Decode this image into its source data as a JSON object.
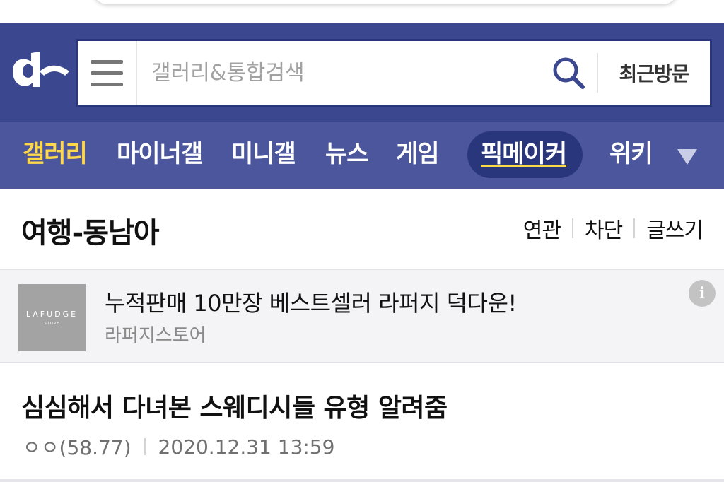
{
  "search": {
    "placeholder": "갤러리&통합검색",
    "recent_label": "최근방문"
  },
  "nav": {
    "items": [
      {
        "label": "갤러리",
        "active": true
      },
      {
        "label": "마이너갤"
      },
      {
        "label": "미니갤"
      },
      {
        "label": "뉴스"
      },
      {
        "label": "게임"
      },
      {
        "label": "픽메이커",
        "highlighted": true
      },
      {
        "label": "위키"
      }
    ]
  },
  "gallery": {
    "title": "여행-동남아",
    "actions": [
      "연관",
      "차단",
      "글쓰기"
    ]
  },
  "ad": {
    "thumb_brand": "LAFUDGE",
    "thumb_sub": "STORE",
    "title": "누적판매 10만장 베스트셀러 라퍼지 덕다운!",
    "source": "라퍼지스토어",
    "info_glyph": "i"
  },
  "post": {
    "title": "심심해서 다녀본 스웨디시들 유형 알려줌",
    "author": "ㅇㅇ(58.77)",
    "date": "2020.12.31 13:59"
  },
  "colors": {
    "header_bg": "#3b4890",
    "nav_bg": "#4b569d",
    "active_accent": "#ffd84a",
    "pill_bg": "#29367c"
  },
  "icons": {
    "logo": "dc-logo-icon",
    "menu": "hamburger-menu-icon",
    "search": "search-icon",
    "more": "chevron-down-icon",
    "info": "info-icon"
  }
}
